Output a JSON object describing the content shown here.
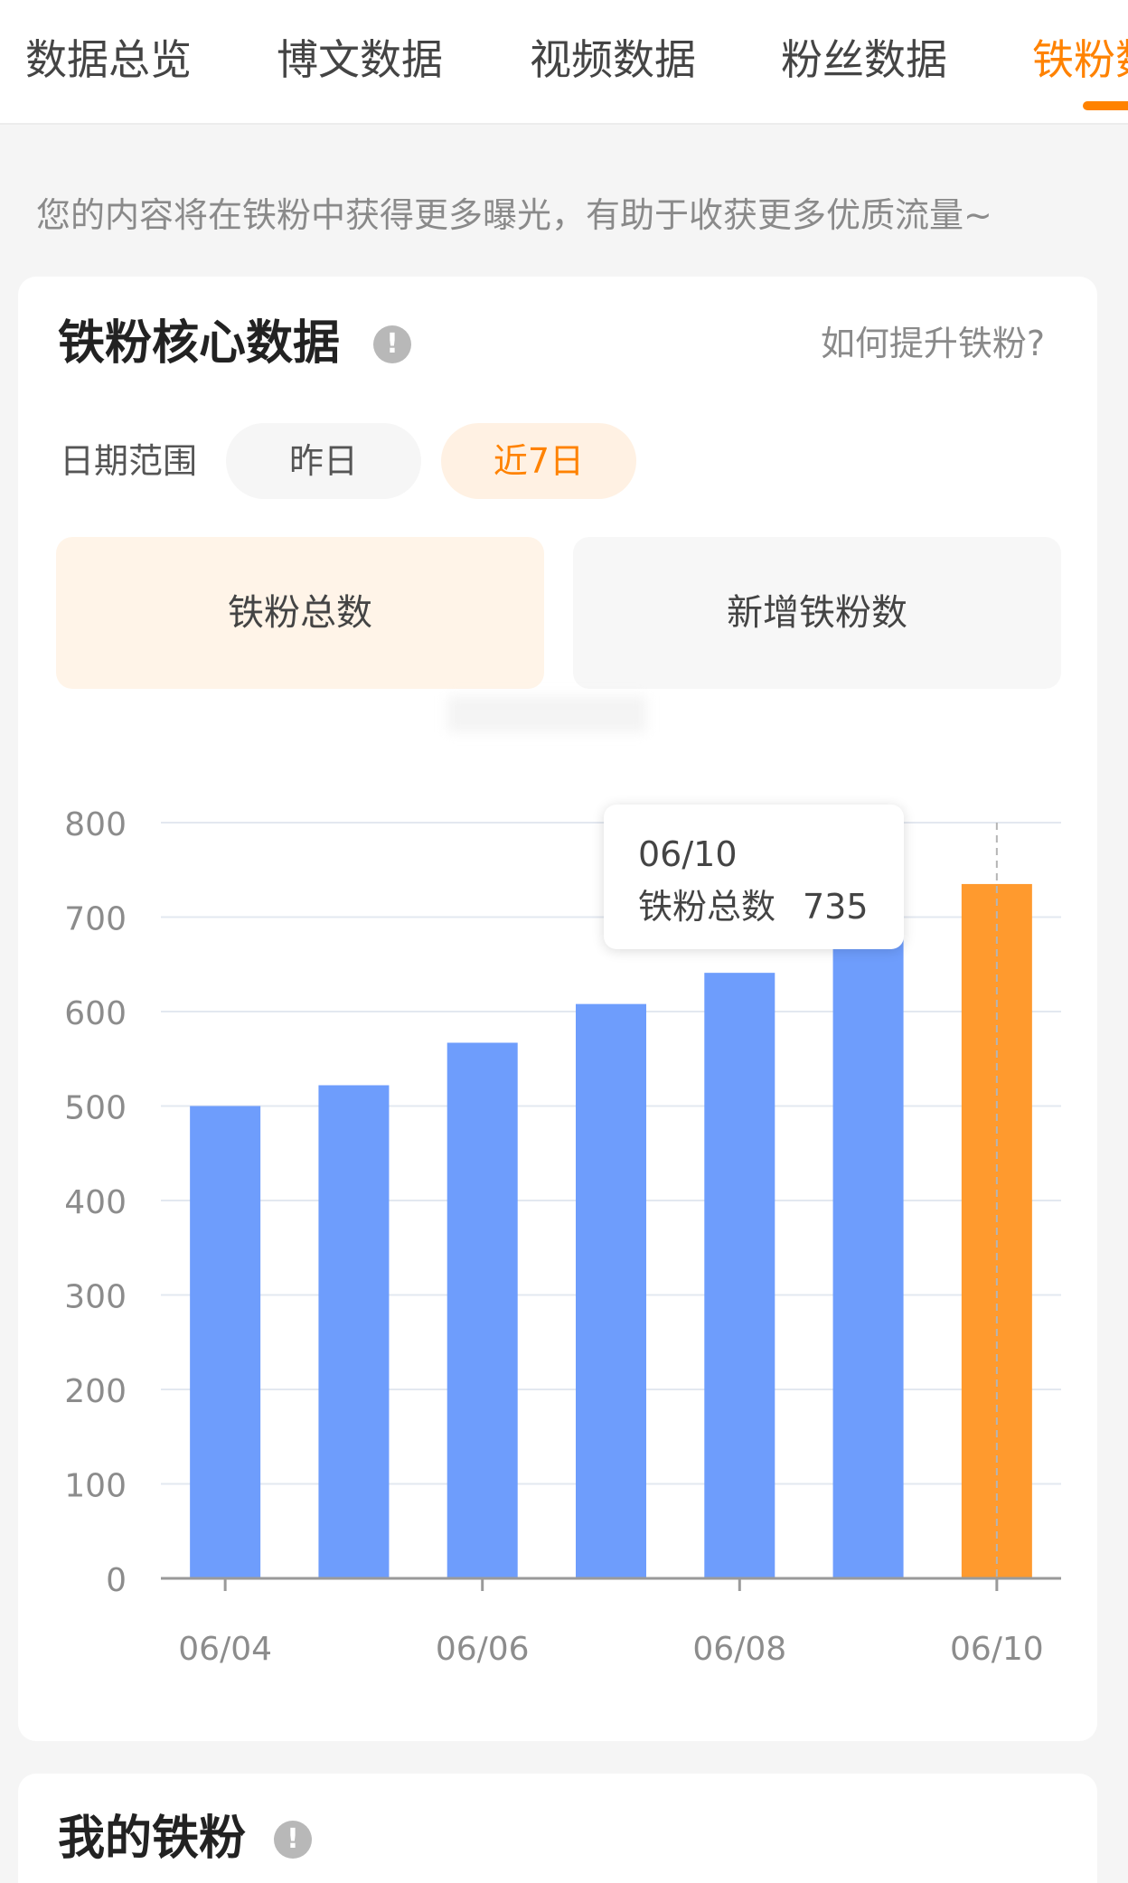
{
  "tabs": [
    {
      "label": "数据总览",
      "active": false
    },
    {
      "label": "博文数据",
      "active": false
    },
    {
      "label": "视频数据",
      "active": false
    },
    {
      "label": "粉丝数据",
      "active": false
    },
    {
      "label": "铁粉数据",
      "active": true
    }
  ],
  "notice": "您的内容将在铁粉中获得更多曝光，有助于收获更多优质流量~",
  "core_card": {
    "title": "铁粉核心数据",
    "help_link": "如何提升铁粉?",
    "date_range_label": "日期范围",
    "range_options": [
      "昨日",
      "近7日"
    ],
    "selected_range": "近7日",
    "metrics": [
      "铁粉总数",
      "新增铁粉数"
    ],
    "selected_metric": "铁粉总数"
  },
  "tooltip": {
    "date": "06/10",
    "series_name": "铁粉总数",
    "value": "735"
  },
  "bottom_card": {
    "title": "我的铁粉"
  },
  "colors": {
    "accent": "#ff8200",
    "bar": "#6e9dfc",
    "bar_highlight": "#ff9a2e"
  },
  "chart_data": {
    "type": "bar",
    "categories": [
      "06/04",
      "06/05",
      "06/06",
      "06/07",
      "06/08",
      "06/09",
      "06/10"
    ],
    "x_tick_labels": [
      "06/04",
      "06/06",
      "06/08",
      "06/10"
    ],
    "series": [
      {
        "name": "铁粉总数",
        "values": [
          500,
          522,
          567,
          608,
          641,
          698,
          735
        ]
      }
    ],
    "highlight_index": 6,
    "ylim": [
      0,
      800
    ],
    "y_ticks": [
      0,
      100,
      200,
      300,
      400,
      500,
      600,
      700,
      800
    ],
    "grid": true
  }
}
